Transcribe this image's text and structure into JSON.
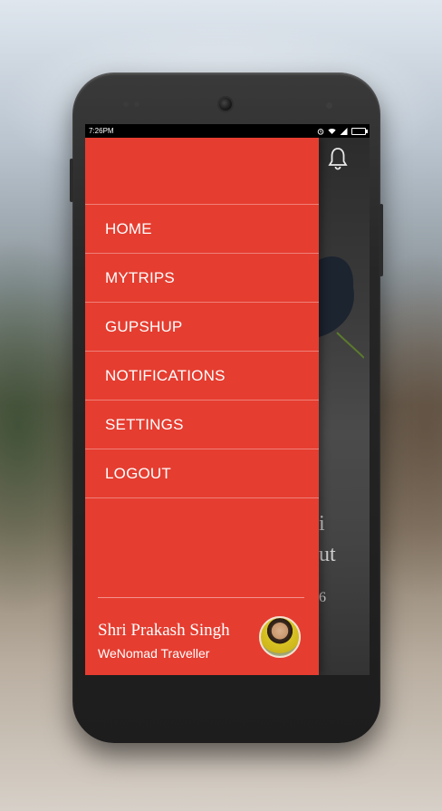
{
  "status_bar": {
    "time": "7:26PM"
  },
  "menu": {
    "items": [
      {
        "label": "HOME"
      },
      {
        "label": "MYTRIPS"
      },
      {
        "label": "GUPSHUP"
      },
      {
        "label": "NOTIFICATIONS"
      },
      {
        "label": "SETTINGS"
      },
      {
        "label": "LOGOUT"
      }
    ]
  },
  "profile": {
    "name": "Shri Prakash Singh",
    "subtitle": "WeNomad Traveller"
  },
  "background_screen": {
    "partial_text_1": "i",
    "partial_text_2": "ut",
    "partial_text_3": "6"
  },
  "icons": {
    "notification": "bell-icon",
    "wifi": "wifi-icon",
    "alarm": "alarm-icon",
    "signal": "signal-icon",
    "battery": "battery-icon"
  },
  "colors": {
    "drawer": "#e53d30",
    "text": "#ffffff",
    "phone_body": "#262626"
  }
}
